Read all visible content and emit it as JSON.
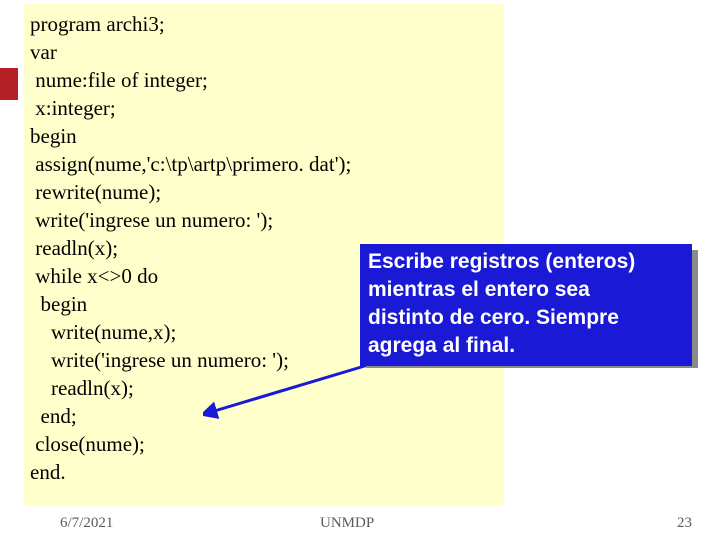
{
  "code": {
    "l1": "program archi3;",
    "l2": "var",
    "l3": " nume:file of integer;",
    "l4": " x:integer;",
    "l5": "begin",
    "l6": " assign(nume,'c:\\tp\\artp\\primero. dat');",
    "l7": " rewrite(nume);",
    "l8": " write('ingrese un numero: ');",
    "l9": " readln(x);",
    "l10": " while x<>0 do",
    "l11": "  begin",
    "l12": "    write(nume,x);",
    "l13": "    write('ingrese un numero: ');",
    "l14": "    readln(x);",
    "l15": "  end;",
    "l16": " close(nume);",
    "l17": "end."
  },
  "callout": {
    "l1": "Escribe registros (enteros)",
    "l2": "mientras el entero sea",
    "l3": "distinto de cero. Siempre",
    "l4": "agrega al final."
  },
  "footer": {
    "date": "6/7/2021",
    "center": "UNMDP",
    "page": "23"
  }
}
